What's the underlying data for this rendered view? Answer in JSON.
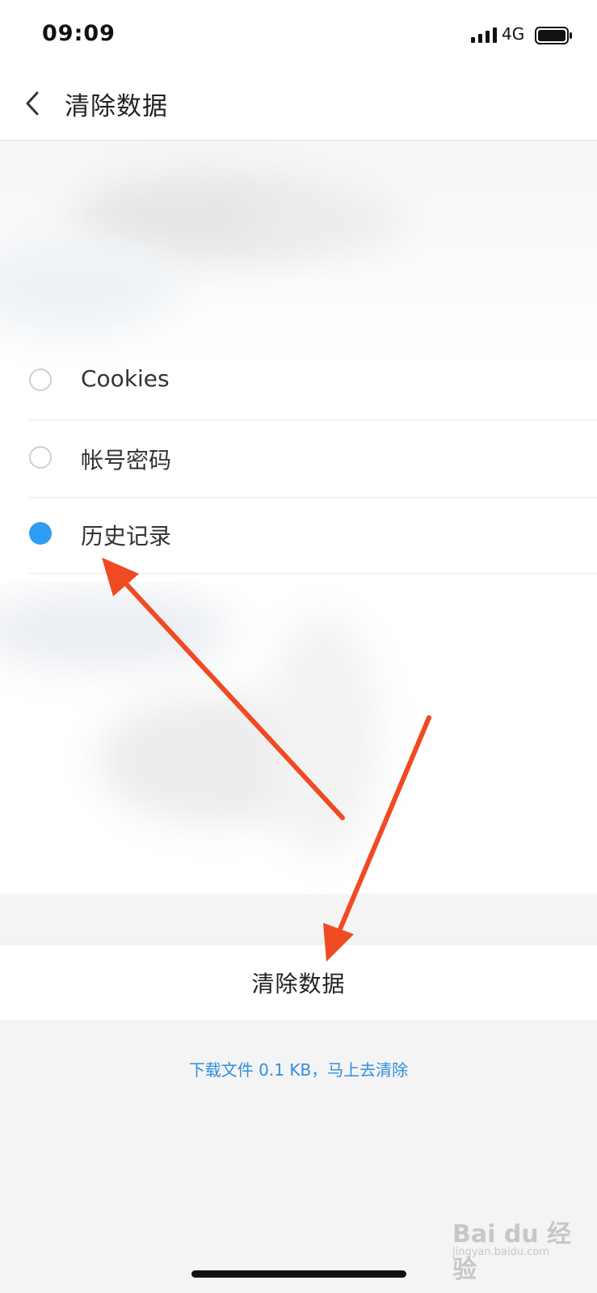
{
  "status_bar": {
    "time": "09:09",
    "network": "4G",
    "signal_icon": "signal-bars-icon",
    "battery_icon": "battery-icon"
  },
  "nav": {
    "back_icon": "chevron-left-icon",
    "title": "清除数据"
  },
  "options": [
    {
      "label": "Cookies",
      "checked": false
    },
    {
      "label": "帐号密码",
      "checked": false
    },
    {
      "label": "历史记录",
      "checked": true
    }
  ],
  "actions": {
    "clear_label": "清除数据"
  },
  "footer": {
    "download_link": "下载文件 0.1 KB，马上去清除"
  },
  "watermark": {
    "text": "Bai du 经验",
    "site": "jingyan.baidu.com"
  },
  "colors": {
    "accent": "#2f9df4",
    "link": "#2f8ee0",
    "annotation_arrow": "#f04a23"
  }
}
